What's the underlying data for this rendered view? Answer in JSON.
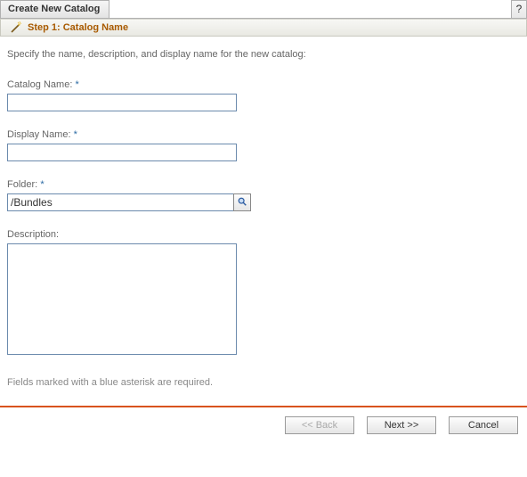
{
  "dialog": {
    "title": "Create New Catalog",
    "help_symbol": "?"
  },
  "step": {
    "title": "Step 1: Catalog Name"
  },
  "intro": "Specify the name, description, and display name for the new catalog:",
  "fields": {
    "catalog_name": {
      "label": "Catalog Name:",
      "required_mark": "*",
      "value": ""
    },
    "display_name": {
      "label": "Display Name:",
      "required_mark": "*",
      "value": ""
    },
    "folder": {
      "label": "Folder:",
      "required_mark": "*",
      "value": "/Bundles"
    },
    "description": {
      "label": "Description:",
      "value": ""
    }
  },
  "footnote": "Fields marked with a blue asterisk are required.",
  "buttons": {
    "back": "<< Back",
    "next": "Next >>",
    "cancel": "Cancel"
  }
}
